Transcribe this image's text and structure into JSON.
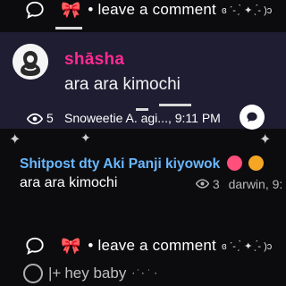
{
  "top_bar": {
    "ribbon_glyph": "🎀",
    "text": "• leave a comment",
    "deco": "ɞ ˊ- ̗ ̀ ✦ ̖ ́- )ɔ"
  },
  "post": {
    "username": "shāsha",
    "message": "ara ara kimochi",
    "meta_count": "5",
    "meta_text": "Snoweetie A. agi..., 9:11 PM",
    "accent_color": "#ff2a92"
  },
  "shitpost": {
    "title": "Shitpost dty Aki Panji kiyowok",
    "message": "ara ara kimochi",
    "meta_count": "3",
    "meta_text": "darwin, 9:"
  },
  "mid_bar": {
    "ribbon_glyph": "🎀",
    "text": "• leave a comment",
    "deco": "ɞ ˊ- ̗ ̀ ✦ ̖ ́- )ɔ"
  },
  "input_bar": {
    "separator": "|+",
    "text": "hey baby",
    "trail": "⋅  ̇  ⋅  ˙  ⋅"
  }
}
